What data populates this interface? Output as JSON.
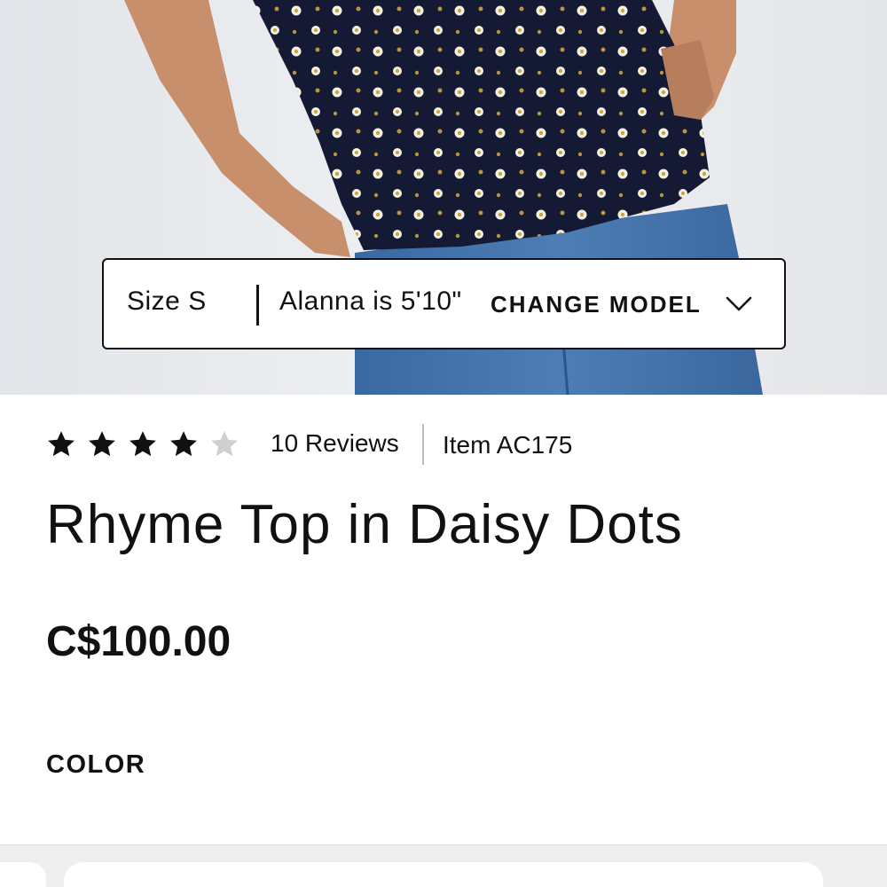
{
  "model_info": {
    "size_text": "Size S",
    "height_text": "Alanna is 5'10\"",
    "change_model_label": "CHANGE MODEL",
    "chevron_icon": "chevron-down-icon"
  },
  "rating": {
    "stars_filled": 4,
    "stars_total": 5,
    "filled_color": "#111111",
    "empty_color": "#cfcfcf",
    "reviews_label": "10 Reviews",
    "item_label": "Item AC175"
  },
  "product": {
    "title": "Rhyme Top in Daisy Dots",
    "price": "C$100.00",
    "color_label": "COLOR"
  },
  "colors": {
    "top_fabric": "#141a33",
    "denim": "#3f6fa6",
    "background": "#e9ebee",
    "skin": "#c88f6c"
  }
}
